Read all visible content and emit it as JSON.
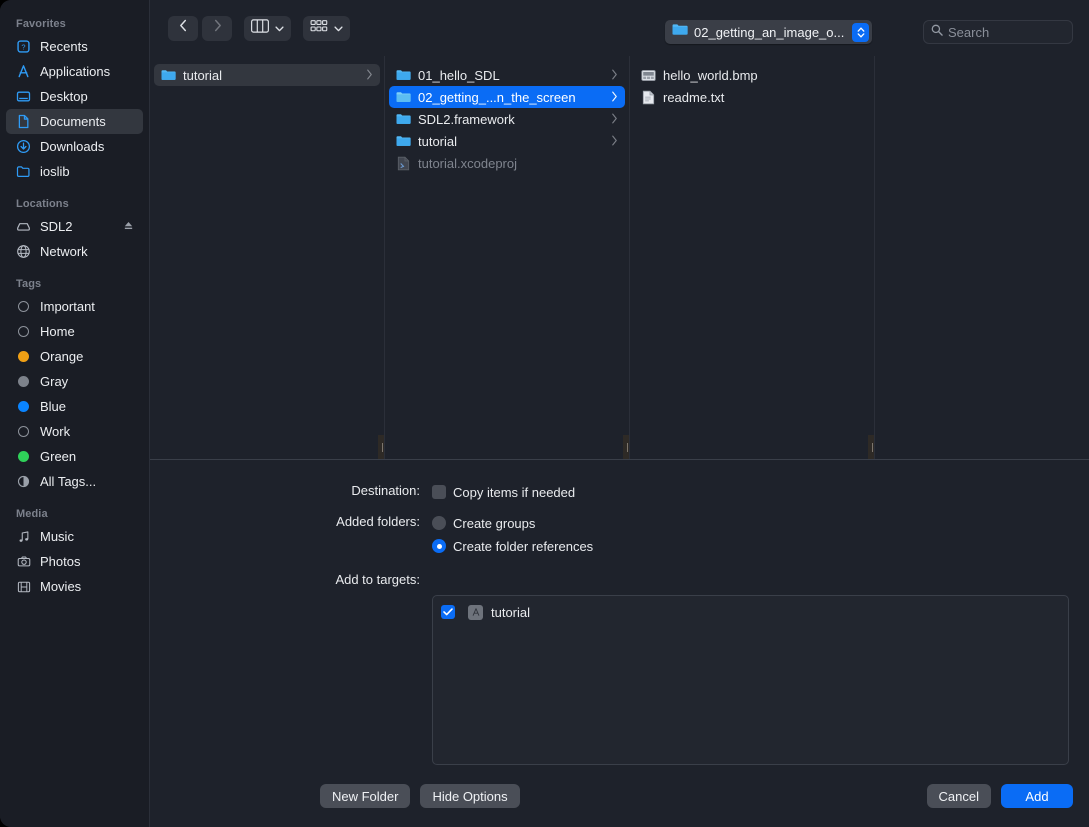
{
  "colors": {
    "accent": "#0a6cf5",
    "window_bg": "#1e222b",
    "sidebar_bg": "#1a1d25",
    "selection_gray": "#33373f",
    "tag_orange": "#f0a015",
    "tag_gray": "#7d828b",
    "tag_blue": "#0a84ff",
    "tag_green": "#2fd159"
  },
  "sidebar": {
    "sections": [
      {
        "header": "Favorites",
        "items": [
          {
            "label": "Recents",
            "icon": "clock-recents-icon",
            "selected": false
          },
          {
            "label": "Applications",
            "icon": "applications-icon",
            "selected": false
          },
          {
            "label": "Desktop",
            "icon": "desktop-icon",
            "selected": false
          },
          {
            "label": "Documents",
            "icon": "documents-icon",
            "selected": true
          },
          {
            "label": "Downloads",
            "icon": "downloads-icon",
            "selected": false
          },
          {
            "label": "ioslib",
            "icon": "folder-icon",
            "selected": false
          }
        ]
      },
      {
        "header": "Locations",
        "items": [
          {
            "label": "SDL2",
            "icon": "disk-icon",
            "selected": false,
            "eject": true
          },
          {
            "label": "Network",
            "icon": "globe-icon",
            "selected": false
          }
        ]
      },
      {
        "header": "Tags",
        "items": [
          {
            "label": "Important",
            "icon": "tag-dot-hollow-icon",
            "color": "none"
          },
          {
            "label": "Home",
            "icon": "tag-dot-hollow-icon",
            "color": "none"
          },
          {
            "label": "Orange",
            "icon": "tag-dot-icon",
            "color": "#f0a015"
          },
          {
            "label": "Gray",
            "icon": "tag-dot-icon",
            "color": "#7d828b"
          },
          {
            "label": "Blue",
            "icon": "tag-dot-icon",
            "color": "#0a84ff"
          },
          {
            "label": "Work",
            "icon": "tag-dot-hollow-icon",
            "color": "none"
          },
          {
            "label": "Green",
            "icon": "tag-dot-icon",
            "color": "#2fd159"
          },
          {
            "label": "All Tags...",
            "icon": "all-tags-icon",
            "color": "none"
          }
        ]
      },
      {
        "header": "Media",
        "items": [
          {
            "label": "Music",
            "icon": "music-note-icon"
          },
          {
            "label": "Photos",
            "icon": "camera-icon"
          },
          {
            "label": "Movies",
            "icon": "film-strip-icon"
          }
        ]
      }
    ]
  },
  "toolbar": {
    "back_icon": "chevron-left-icon",
    "forward_icon": "chevron-right-icon",
    "view_mode_icon": "column-view-icon",
    "group_by_icon": "group-by-icon",
    "path_label": "02_getting_an_image_o...",
    "path_icon": "folder-icon",
    "stepper_icon": "up-down-stepper-icon",
    "search": {
      "placeholder": "Search",
      "value": "",
      "icon": "search-icon"
    }
  },
  "browser": {
    "columns": [
      {
        "name": "column-1",
        "items": [
          {
            "label": "tutorial",
            "icon": "folder-icon",
            "state": "selected-gray",
            "arrow": true
          }
        ]
      },
      {
        "name": "column-2",
        "items": [
          {
            "label": "01_hello_SDL",
            "icon": "folder-icon",
            "state": "normal",
            "arrow": true
          },
          {
            "label": "02_getting_...n_the_screen",
            "icon": "folder-icon",
            "state": "selected-blue",
            "arrow": true
          },
          {
            "label": "SDL2.framework",
            "icon": "folder-icon",
            "state": "normal",
            "arrow": true
          },
          {
            "label": "tutorial",
            "icon": "folder-icon",
            "state": "normal",
            "arrow": true
          },
          {
            "label": "tutorial.xcodeproj",
            "icon": "xcodeproj-icon",
            "state": "dimmed",
            "arrow": false
          }
        ]
      },
      {
        "name": "column-3",
        "items": [
          {
            "label": "hello_world.bmp",
            "icon": "bmp-image-icon",
            "state": "normal",
            "arrow": false
          },
          {
            "label": "readme.txt",
            "icon": "text-document-icon",
            "state": "normal",
            "arrow": false
          }
        ]
      },
      {
        "name": "column-4",
        "items": []
      }
    ]
  },
  "options": {
    "destination": {
      "label": "Destination:",
      "checkbox_label": "Copy items if needed",
      "checked": false
    },
    "added_folders": {
      "label": "Added folders:",
      "choices": [
        {
          "label": "Create groups",
          "selected": false
        },
        {
          "label": "Create folder references",
          "selected": true
        }
      ]
    },
    "add_to_targets": {
      "label": "Add to targets:",
      "rows": [
        {
          "label": "tutorial",
          "checked": true,
          "icon": "app-target-icon"
        }
      ]
    }
  },
  "footer": {
    "new_folder_label": "New Folder",
    "hide_options_label": "Hide Options",
    "cancel_label": "Cancel",
    "add_label": "Add"
  }
}
